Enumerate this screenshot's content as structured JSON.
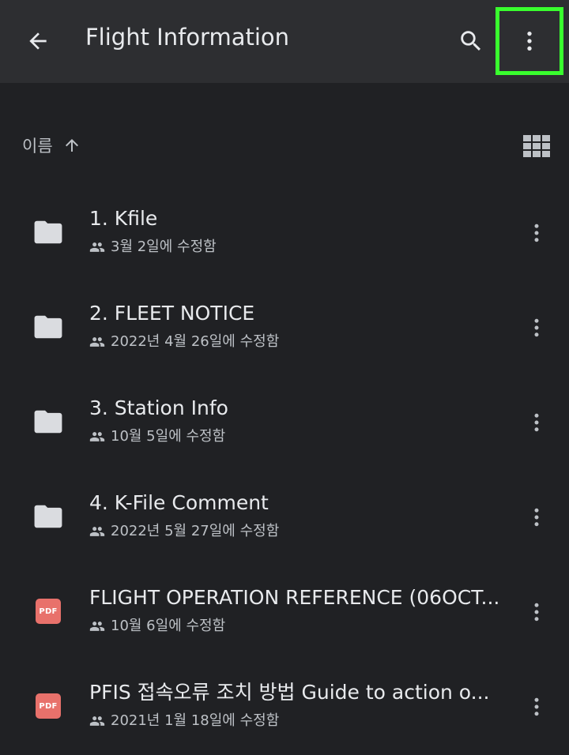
{
  "appbar": {
    "title": "Flight Information",
    "back_icon": "arrow-back-icon",
    "search_icon": "search-icon",
    "more_icon": "more-vert-icon",
    "highlight_color": "#39ff2e"
  },
  "sort": {
    "label": "이름",
    "direction_icon": "arrow-up-icon",
    "view_icon": "grid-view-icon"
  },
  "files": [
    {
      "name": "1. Kfile",
      "modified": "3월 2일에 수정함",
      "type": "folder",
      "shared": true
    },
    {
      "name": "2. FLEET NOTICE",
      "modified": "2022년 4월 26일에 수정함",
      "type": "folder",
      "shared": true
    },
    {
      "name": "3. Station Info",
      "modified": "10월 5일에 수정함",
      "type": "folder",
      "shared": true
    },
    {
      "name": "4. K-File Comment",
      "modified": "2022년 5월 27일에 수정함",
      "type": "folder",
      "shared": true
    },
    {
      "name": "FLIGHT OPERATION REFERENCE (06OCT...",
      "modified": "10월 6일에 수정함",
      "type": "pdf",
      "badge": "PDF",
      "shared": true
    },
    {
      "name": "PFIS 접속오류 조치 방법  Guide to action o...",
      "modified": "2021년 1월 18일에 수정함",
      "type": "pdf",
      "badge": "PDF",
      "shared": true
    }
  ],
  "colors": {
    "background": "#202124",
    "appbar": "#2d2e31",
    "pdf_badge": "#e8716b",
    "folder_icon": "#dadce0"
  }
}
